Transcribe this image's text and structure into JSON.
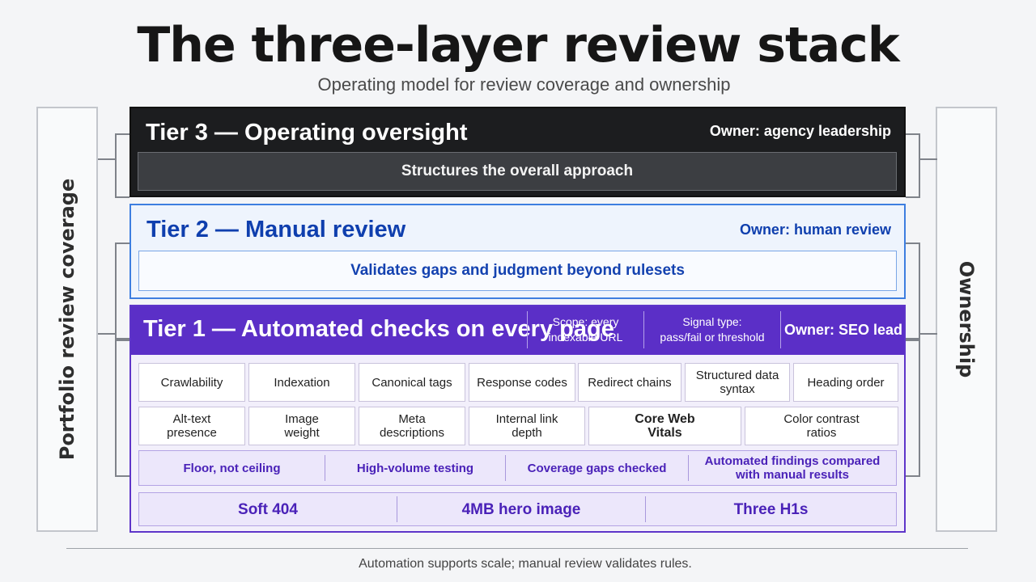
{
  "title": "The three-layer review stack",
  "subtitle": "Operating model for review coverage and ownership",
  "left_label": "Portfolio review coverage",
  "right_label": "Ownership",
  "tier3": {
    "title": "Tier 3 — Operating oversight",
    "owner": "Owner: agency leadership",
    "band": "Structures the overall approach"
  },
  "tier2": {
    "title": "Tier 2 — Manual review",
    "owner": "Owner: human review",
    "band": "Validates gaps and judgment beyond rulesets"
  },
  "tier1": {
    "title": "Tier 1 — Automated checks on every page",
    "scope": "Scope: every\nindexable URL",
    "signal": "Signal type:\npass/fail or threshold",
    "owner": "Owner: SEO lead",
    "checks_row1": [
      "Crawlability",
      "Indexation",
      "Canonical tags",
      "Response codes",
      "Redirect chains",
      "Structured data\nsyntax",
      "Heading order"
    ],
    "checks_row2": [
      "Alt-text\npresence",
      "Image\nweight",
      "Meta\ndescriptions",
      "Internal link\ndepth",
      "Core Web\nVitals",
      "Color contrast\nratios"
    ],
    "principles": [
      "Floor, not ceiling",
      "High-volume testing",
      "Coverage gaps checked",
      "Automated findings compared\nwith manual results"
    ],
    "examples": [
      "Soft 404",
      "4MB hero image",
      "Three H1s"
    ]
  },
  "footer": "Automation supports scale; manual review validates rules.",
  "colors": {
    "tier3": "#1c1d1f",
    "tier2_accent": "#3d7ee0",
    "tier1_accent": "#5b2fc7"
  }
}
